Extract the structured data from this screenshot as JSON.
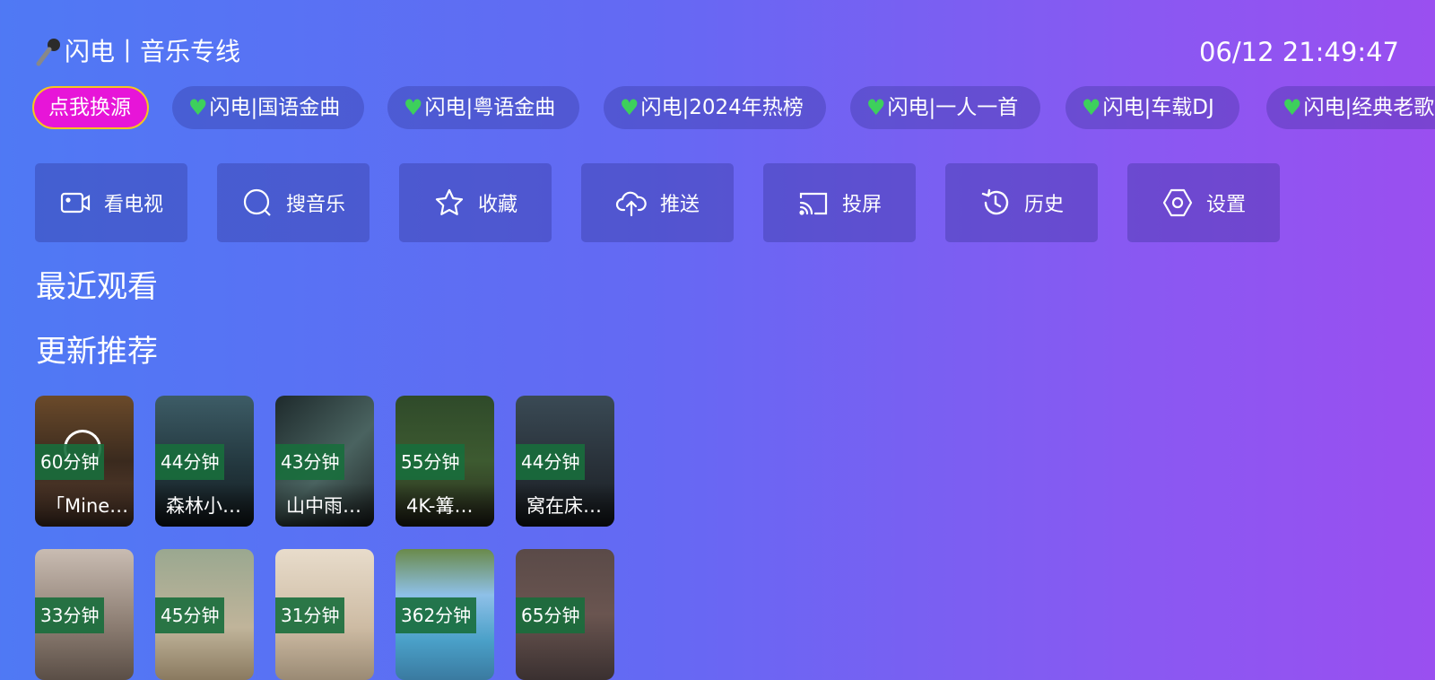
{
  "header": {
    "title": "闪电丨音乐专线",
    "clock": "06/12 21:49:47"
  },
  "source_button": "点我换源",
  "chips": [
    "闪电|国语金曲",
    "闪电|粤语金曲",
    "闪电|2024年热榜",
    "闪电|一人一首",
    "闪电|车载DJ",
    "闪电|经典老歌"
  ],
  "nav": [
    {
      "label": "看电视",
      "icon": "tv-camera-icon"
    },
    {
      "label": "搜音乐",
      "icon": "search-icon"
    },
    {
      "label": "收藏",
      "icon": "star-icon"
    },
    {
      "label": "推送",
      "icon": "cloud-upload-icon"
    },
    {
      "label": "投屏",
      "icon": "cast-icon"
    },
    {
      "label": "历史",
      "icon": "history-icon"
    },
    {
      "label": "设置",
      "icon": "settings-hexagon-icon"
    }
  ],
  "sections": {
    "recent": "最近观看",
    "recommended": "更新推荐"
  },
  "cards_row1": [
    {
      "duration": "60分钟",
      "title": "「Mine…"
    },
    {
      "duration": "44分钟",
      "title": "森林小…"
    },
    {
      "duration": "43分钟",
      "title": "山中雨…"
    },
    {
      "duration": "55分钟",
      "title": "4K-篝…"
    },
    {
      "duration": "44分钟",
      "title": "窝在床…"
    }
  ],
  "cards_row2": [
    {
      "duration": "33分钟"
    },
    {
      "duration": "45分钟"
    },
    {
      "duration": "31分钟"
    },
    {
      "duration": "362分钟"
    },
    {
      "duration": "65分钟"
    }
  ],
  "colors": {
    "source_button": "#e715d8",
    "source_border": "#f5c61d",
    "duration_badge": "#186e3c",
    "heart": "#3dd05c"
  }
}
